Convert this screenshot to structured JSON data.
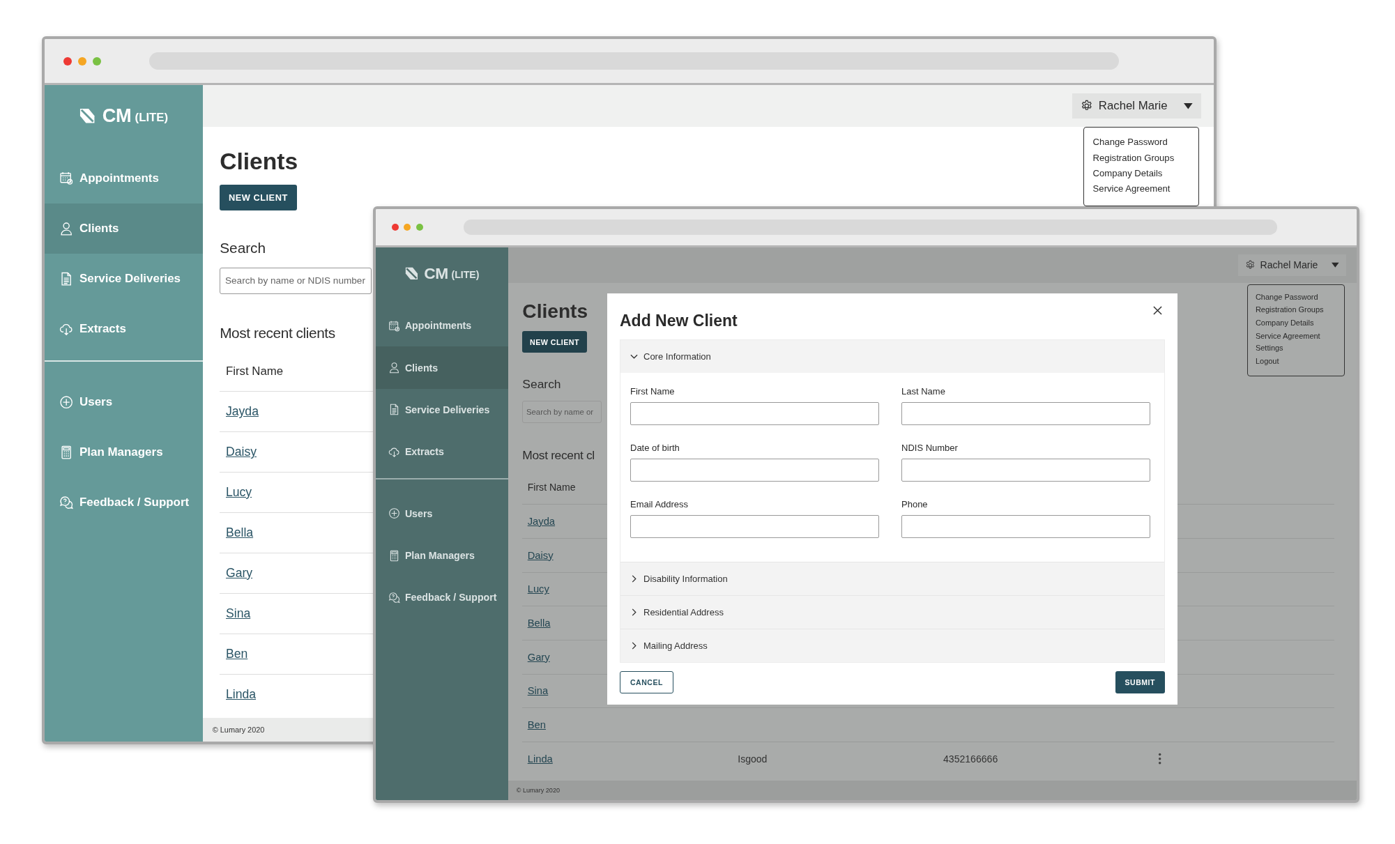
{
  "windows": [
    {
      "kind": "back",
      "sidebar": {
        "logo": "CM",
        "logo_suffix": "(LITE)",
        "nav_groups": [
          [
            {
              "label": "Appointments",
              "selected": false
            },
            {
              "label": "Clients",
              "selected": true
            },
            {
              "label": "Service Deliveries",
              "selected": false
            },
            {
              "label": "Extracts",
              "selected": false
            }
          ],
          [
            {
              "label": "Users",
              "selected": false
            },
            {
              "label": "Plan Managers",
              "selected": false
            },
            {
              "label": "Feedback / Support",
              "selected": false
            }
          ]
        ]
      },
      "user_menu": {
        "name": "Rachel Marie",
        "expanded": true,
        "items": [
          "Change Password",
          "Registration Groups",
          "Company Details",
          "Service Agreement"
        ]
      },
      "page": {
        "title": "Clients",
        "new_button": "NEW CLIENT",
        "search_label": "Search",
        "search": {
          "placeholder": "Search by name or NDIS number"
        },
        "recent_title": "Most recent clients",
        "table": {
          "columns": [
            "First Name"
          ],
          "rows": [
            {
              "cells": [
                "Jayda"
              ]
            },
            {
              "cells": [
                "Daisy"
              ]
            },
            {
              "cells": [
                "Lucy"
              ]
            },
            {
              "cells": [
                "Bella"
              ]
            },
            {
              "cells": [
                "Gary"
              ]
            },
            {
              "cells": [
                "Sina"
              ]
            },
            {
              "cells": [
                "Ben"
              ]
            },
            {
              "cells": [
                "Linda"
              ]
            }
          ]
        }
      },
      "footer": "© Lumary 2020"
    },
    {
      "kind": "front",
      "sidebar": {
        "logo": "CM",
        "logo_suffix": "(LITE)",
        "nav_groups": [
          [
            {
              "label": "Appointments",
              "selected": false
            },
            {
              "label": "Clients",
              "selected": true
            },
            {
              "label": "Service Deliveries",
              "selected": false
            },
            {
              "label": "Extracts",
              "selected": false
            }
          ],
          [
            {
              "label": "Users",
              "selected": false
            },
            {
              "label": "Plan Managers",
              "selected": false
            },
            {
              "label": "Feedback / Support",
              "selected": false
            }
          ]
        ]
      },
      "user_menu": {
        "name": "Rachel Marie",
        "expanded": true,
        "items": [
          "Change Password",
          "Registration Groups",
          "Company Details",
          "Service Agreement Settings",
          "Logout"
        ]
      },
      "page": {
        "title": "Clients",
        "new_button": "NEW CLIENT",
        "search_label": "Search",
        "search": {
          "placeholder": "Search by name or"
        },
        "recent_title": "Most recent cl",
        "table": {
          "columns": [
            "First Name"
          ],
          "rows": [
            {
              "cells": [
                "Jayda"
              ]
            },
            {
              "cells": [
                "Daisy"
              ]
            },
            {
              "cells": [
                "Lucy"
              ]
            },
            {
              "cells": [
                "Bella"
              ]
            },
            {
              "cells": [
                "Gary"
              ]
            },
            {
              "cells": [
                "Sina"
              ]
            },
            {
              "cells": [
                "Ben"
              ]
            },
            {
              "cells": [
                "Linda",
                "Isgood",
                "4352166666"
              ],
              "actions": true
            }
          ]
        }
      },
      "footer": "© Lumary 2020",
      "modal": {
        "title": "Add New Client",
        "sections": [
          {
            "title": "Core Information",
            "expanded": true,
            "fields": [
              {
                "label": "First Name"
              },
              {
                "label": "Last Name"
              },
              {
                "label": "Date of birth"
              },
              {
                "label": "NDIS Number"
              },
              {
                "label": "Email Address"
              },
              {
                "label": "Phone"
              }
            ]
          },
          {
            "title": "Disability Information",
            "expanded": false
          },
          {
            "title": "Residential Address",
            "expanded": false
          },
          {
            "title": "Mailing Address",
            "expanded": false
          }
        ],
        "cancel": "CANCEL",
        "submit": "SUBMIT"
      }
    }
  ]
}
